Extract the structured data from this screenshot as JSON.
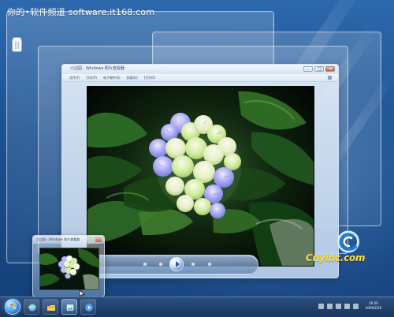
{
  "watermark": {
    "text": "你的•软件频道 software.it168.com"
  },
  "window": {
    "title": "六边园 - Windows 照片查看器",
    "menu": [
      {
        "label": "文件(F)"
      },
      {
        "label": "打印(P)"
      },
      {
        "label": "电子邮件(E)"
      },
      {
        "label": "刻录(U)"
      },
      {
        "label": "打开(O)"
      }
    ]
  },
  "preview": {
    "title": "六边园 - Windows 照片查看器"
  },
  "site_mark": {
    "text": "Cnyinc.com"
  },
  "taskbar": {
    "clock_time": "16:50",
    "clock_date": "2009/2/26"
  },
  "icons": {
    "desktop": "recycle-bin-icon",
    "start": "windows-logo-icon",
    "ie": "internet-explorer-icon",
    "folder": "folder-icon",
    "viewer": "photo-viewer-icon",
    "media": "media-player-icon",
    "cursor": "mouse-cursor-icon",
    "logo": "site-logo-icon"
  }
}
